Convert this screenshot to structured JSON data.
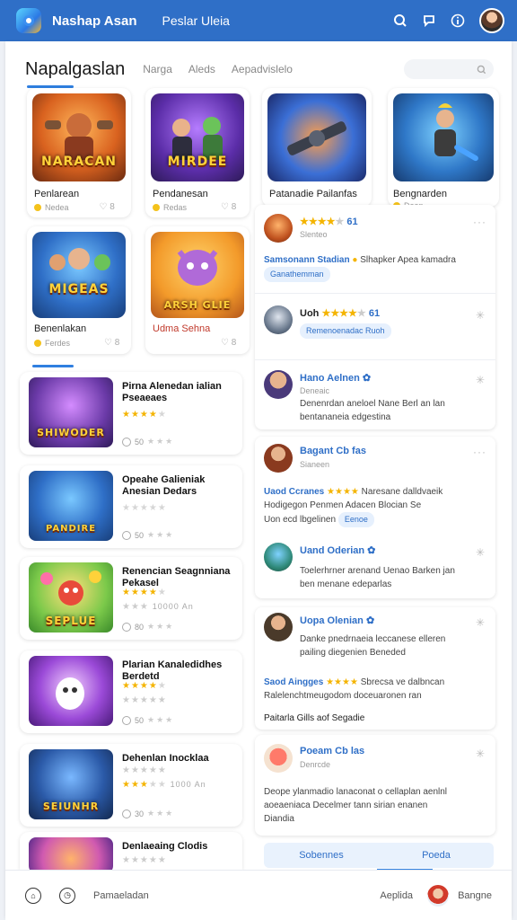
{
  "topbar": {
    "title": "Nashap Asan",
    "link": "Peslar Uleia",
    "colors": {
      "bar": "#2f6fc7"
    }
  },
  "header": {
    "title": "Napalgaslan",
    "nav": [
      "Narga",
      "Aleds",
      "Aepadvislelo"
    ]
  },
  "grid": [
    {
      "thumb_text": "NARACAN",
      "title": "Penlarean",
      "meta": "Nedea"
    },
    {
      "thumb_text": "MIRDEE",
      "title": "Pendanesan",
      "meta": "Redas"
    },
    {
      "thumb_text": "",
      "title": "Patanadie Pailanfas",
      "meta": ""
    },
    {
      "thumb_text": "",
      "title": "Bengnarden",
      "meta": "Dean"
    },
    {
      "thumb_text": "MIGEAS",
      "title": "Benenlakan",
      "meta": "Ferdes"
    },
    {
      "thumb_text": "ARSH GLIE",
      "title": "Udma Sehna",
      "meta": ""
    }
  ],
  "list": [
    {
      "thumb_text": "SHIWODER",
      "title": "Pirna Alenedan ialian Pseaeaes",
      "stars_meta": "",
      "meta": "50"
    },
    {
      "thumb_text": "PANDIRE",
      "title": "Opeahe Galieniak Anesian Dedars",
      "stars_meta": "",
      "meta": "50"
    },
    {
      "thumb_text": "SEPLUE",
      "title": "Renencian Seagnniana Pekasel",
      "stars_meta": "10000 An",
      "meta": "80"
    },
    {
      "thumb_text": "",
      "title": "Plarian Kanaledidhes Berdetd",
      "stars_meta": "",
      "meta": "50"
    },
    {
      "thumb_text": "SEIUNHR",
      "title": "Dehenlan Inocklaa",
      "stars_meta": "1000 An",
      "meta": "30"
    },
    {
      "thumb_text": "",
      "title": "Denlaeaing Clodis",
      "stars_meta": "",
      "meta": ""
    }
  ],
  "reviews": {
    "panel1": [
      {
        "name": "",
        "rating_text": "61",
        "date": "Slenteo",
        "text1": "Samsonann Stadian",
        "text2": "Slhapker Apea kamadra",
        "tag": "Ganathemman"
      },
      {
        "name": "Uoh",
        "rating_text": "61",
        "date": "",
        "text1": "",
        "text2": "",
        "tag": "Remenoenadac Ruoh"
      },
      {
        "name": "Hano Aelnen",
        "rating_text": "",
        "date": "Deneaic",
        "text1": "Denenrdan aneloel Nane Berl an lan",
        "text2": "bentananeia edgestina"
      }
    ],
    "panel2": [
      {
        "name": "Bagant Cb fas",
        "date": "Sianeen",
        "text_name": "Uaod Ccranes",
        "text1": "Naresane dalldvaeik",
        "text2": "Hodigegon Penmen Adacen Blocian Se",
        "text3": "Uon ecd lbgelinen",
        "tag": "Eenoe"
      },
      {
        "name": "Uand Oderian",
        "date": "",
        "text1": "Toelerhrner arenand Uenao Barken jan",
        "text2": "ben menane edeparlas"
      }
    ],
    "panel3": [
      {
        "name": "Uopa Olenian",
        "date": "",
        "text1": "Danke pnedrnaeia leccanese elleren",
        "text2": "pailing diegenien Beneded"
      },
      {
        "name": "Saod Aingges",
        "date": "",
        "text1": "Sbrecsa ve dalbncan",
        "text2": "Ralelenchtmeugodom doceuaronen ran"
      },
      {
        "name": "Paitarla Gills",
        "date": "",
        "text_tail": "aof Segadie"
      }
    ],
    "panel4": [
      {
        "name": "Poeam Cb las",
        "date": "Denrcde",
        "text1": "Deope ylanmadio lanaconat o cellaplan aenlnl",
        "text2": "aoeaeniaca Decelmer tann sirian enanen",
        "text3": "Diandia"
      }
    ],
    "tabs": [
      "Sobennes",
      "Poeda"
    ]
  },
  "bottom": {
    "left_label": "Pamaeladan",
    "right_label": "Aeplida",
    "user_label": "Bangne"
  },
  "accent": "#2f7fe0",
  "star_color": "#f4b400"
}
